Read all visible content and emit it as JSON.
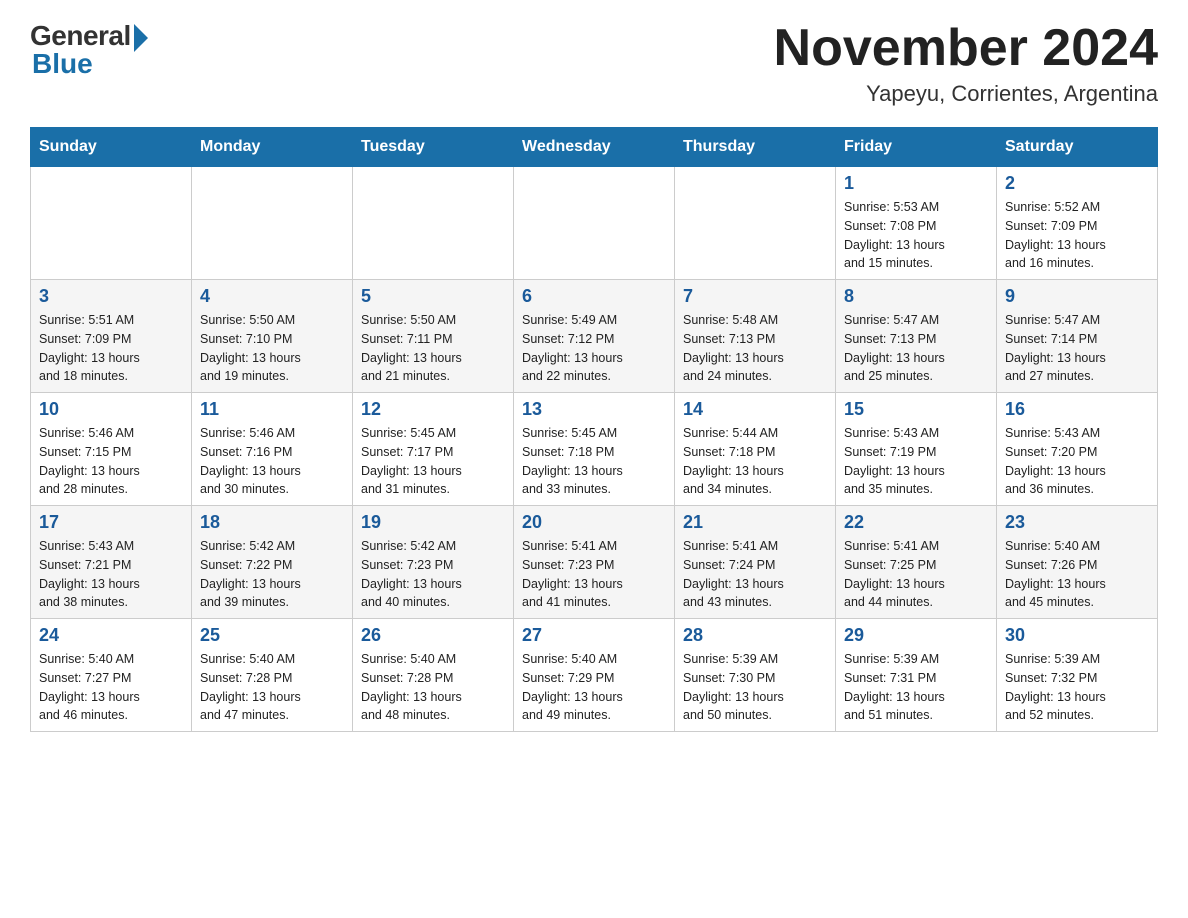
{
  "header": {
    "logo_general": "General",
    "logo_blue": "Blue",
    "month_title": "November 2024",
    "location": "Yapeyu, Corrientes, Argentina"
  },
  "weekdays": [
    "Sunday",
    "Monday",
    "Tuesday",
    "Wednesday",
    "Thursday",
    "Friday",
    "Saturday"
  ],
  "weeks": [
    [
      {
        "day": "",
        "info": ""
      },
      {
        "day": "",
        "info": ""
      },
      {
        "day": "",
        "info": ""
      },
      {
        "day": "",
        "info": ""
      },
      {
        "day": "",
        "info": ""
      },
      {
        "day": "1",
        "info": "Sunrise: 5:53 AM\nSunset: 7:08 PM\nDaylight: 13 hours\nand 15 minutes."
      },
      {
        "day": "2",
        "info": "Sunrise: 5:52 AM\nSunset: 7:09 PM\nDaylight: 13 hours\nand 16 minutes."
      }
    ],
    [
      {
        "day": "3",
        "info": "Sunrise: 5:51 AM\nSunset: 7:09 PM\nDaylight: 13 hours\nand 18 minutes."
      },
      {
        "day": "4",
        "info": "Sunrise: 5:50 AM\nSunset: 7:10 PM\nDaylight: 13 hours\nand 19 minutes."
      },
      {
        "day": "5",
        "info": "Sunrise: 5:50 AM\nSunset: 7:11 PM\nDaylight: 13 hours\nand 21 minutes."
      },
      {
        "day": "6",
        "info": "Sunrise: 5:49 AM\nSunset: 7:12 PM\nDaylight: 13 hours\nand 22 minutes."
      },
      {
        "day": "7",
        "info": "Sunrise: 5:48 AM\nSunset: 7:13 PM\nDaylight: 13 hours\nand 24 minutes."
      },
      {
        "day": "8",
        "info": "Sunrise: 5:47 AM\nSunset: 7:13 PM\nDaylight: 13 hours\nand 25 minutes."
      },
      {
        "day": "9",
        "info": "Sunrise: 5:47 AM\nSunset: 7:14 PM\nDaylight: 13 hours\nand 27 minutes."
      }
    ],
    [
      {
        "day": "10",
        "info": "Sunrise: 5:46 AM\nSunset: 7:15 PM\nDaylight: 13 hours\nand 28 minutes."
      },
      {
        "day": "11",
        "info": "Sunrise: 5:46 AM\nSunset: 7:16 PM\nDaylight: 13 hours\nand 30 minutes."
      },
      {
        "day": "12",
        "info": "Sunrise: 5:45 AM\nSunset: 7:17 PM\nDaylight: 13 hours\nand 31 minutes."
      },
      {
        "day": "13",
        "info": "Sunrise: 5:45 AM\nSunset: 7:18 PM\nDaylight: 13 hours\nand 33 minutes."
      },
      {
        "day": "14",
        "info": "Sunrise: 5:44 AM\nSunset: 7:18 PM\nDaylight: 13 hours\nand 34 minutes."
      },
      {
        "day": "15",
        "info": "Sunrise: 5:43 AM\nSunset: 7:19 PM\nDaylight: 13 hours\nand 35 minutes."
      },
      {
        "day": "16",
        "info": "Sunrise: 5:43 AM\nSunset: 7:20 PM\nDaylight: 13 hours\nand 36 minutes."
      }
    ],
    [
      {
        "day": "17",
        "info": "Sunrise: 5:43 AM\nSunset: 7:21 PM\nDaylight: 13 hours\nand 38 minutes."
      },
      {
        "day": "18",
        "info": "Sunrise: 5:42 AM\nSunset: 7:22 PM\nDaylight: 13 hours\nand 39 minutes."
      },
      {
        "day": "19",
        "info": "Sunrise: 5:42 AM\nSunset: 7:23 PM\nDaylight: 13 hours\nand 40 minutes."
      },
      {
        "day": "20",
        "info": "Sunrise: 5:41 AM\nSunset: 7:23 PM\nDaylight: 13 hours\nand 41 minutes."
      },
      {
        "day": "21",
        "info": "Sunrise: 5:41 AM\nSunset: 7:24 PM\nDaylight: 13 hours\nand 43 minutes."
      },
      {
        "day": "22",
        "info": "Sunrise: 5:41 AM\nSunset: 7:25 PM\nDaylight: 13 hours\nand 44 minutes."
      },
      {
        "day": "23",
        "info": "Sunrise: 5:40 AM\nSunset: 7:26 PM\nDaylight: 13 hours\nand 45 minutes."
      }
    ],
    [
      {
        "day": "24",
        "info": "Sunrise: 5:40 AM\nSunset: 7:27 PM\nDaylight: 13 hours\nand 46 minutes."
      },
      {
        "day": "25",
        "info": "Sunrise: 5:40 AM\nSunset: 7:28 PM\nDaylight: 13 hours\nand 47 minutes."
      },
      {
        "day": "26",
        "info": "Sunrise: 5:40 AM\nSunset: 7:28 PM\nDaylight: 13 hours\nand 48 minutes."
      },
      {
        "day": "27",
        "info": "Sunrise: 5:40 AM\nSunset: 7:29 PM\nDaylight: 13 hours\nand 49 minutes."
      },
      {
        "day": "28",
        "info": "Sunrise: 5:39 AM\nSunset: 7:30 PM\nDaylight: 13 hours\nand 50 minutes."
      },
      {
        "day": "29",
        "info": "Sunrise: 5:39 AM\nSunset: 7:31 PM\nDaylight: 13 hours\nand 51 minutes."
      },
      {
        "day": "30",
        "info": "Sunrise: 5:39 AM\nSunset: 7:32 PM\nDaylight: 13 hours\nand 52 minutes."
      }
    ]
  ]
}
